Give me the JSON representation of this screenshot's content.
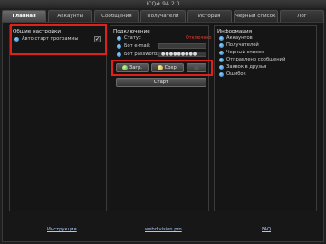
{
  "window": {
    "title": "ICQ# 9A 2.0"
  },
  "tabs": [
    {
      "label": "Главная"
    },
    {
      "label": "Аккаунты"
    },
    {
      "label": "Сообщения"
    },
    {
      "label": "Получатели"
    },
    {
      "label": "История"
    },
    {
      "label": "Черный список"
    },
    {
      "label": "Лог"
    }
  ],
  "settings": {
    "title": "Общие настройки",
    "autostart_label": "Авто старт программы",
    "autostart_checked": "✓"
  },
  "connection": {
    "title": "Подключение",
    "status_label": "Статус",
    "status_value": "Отключено",
    "email_label": "Бот e-mail:",
    "email_value": "",
    "password_label": "Бот password:",
    "password_value": "●●●●●●●●●"
  },
  "buttons": {
    "load": "Загр.",
    "save": "Сохр.",
    "start": "Старт"
  },
  "info": {
    "title": "Информация",
    "items": [
      "Аккаунтов",
      "Получателей",
      "Черный список",
      "Отправлено сообщений",
      "Заявок в друзья",
      "Ошибок"
    ]
  },
  "footer": {
    "instructions": "Инструкция",
    "site": "webdivision.pro",
    "faq": "FAQ"
  },
  "colors": {
    "highlight": "#e0201b",
    "accent_dot": "#2a7fc0"
  }
}
